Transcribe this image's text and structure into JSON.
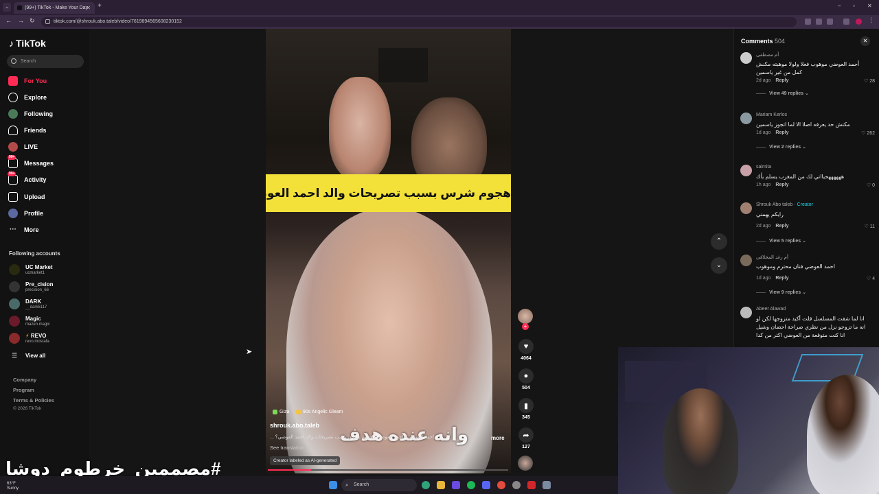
{
  "browser": {
    "tab_title": "(99+) TikTok - Make Your Day",
    "url": "tiktok.com/@shrouk.abo.taleb/video/7619894565608230152"
  },
  "sidebar": {
    "logo": "TikTok",
    "search_placeholder": "Search",
    "nav": [
      {
        "label": "For You",
        "icon": "home-icon",
        "active": true
      },
      {
        "label": "Explore",
        "icon": "compass-icon"
      },
      {
        "label": "Following",
        "icon": "following-icon"
      },
      {
        "label": "Friends",
        "icon": "friends-icon"
      },
      {
        "label": "LIVE",
        "icon": "live-icon"
      },
      {
        "label": "Messages",
        "icon": "messages-icon",
        "badge": "99+"
      },
      {
        "label": "Activity",
        "icon": "activity-icon",
        "badge": "99+"
      },
      {
        "label": "Upload",
        "icon": "upload-icon"
      },
      {
        "label": "Profile",
        "icon": "profile-icon"
      },
      {
        "label": "More",
        "icon": "more-icon"
      }
    ],
    "following_title": "Following accounts",
    "following": [
      {
        "name": "UC Market",
        "handle": "ucmarket1"
      },
      {
        "name": "Pre_cision",
        "handle": "precision_66"
      },
      {
        "name": "DARK",
        "handle": "__dark5117"
      },
      {
        "name": "Magic",
        "handle": "mazen.magic"
      },
      {
        "name": "REVO",
        "handle": "revo.mostafa"
      }
    ],
    "view_all": "View all",
    "footer": [
      "Company",
      "Program",
      "Terms & Policies",
      "© 2026 TikTok"
    ]
  },
  "video": {
    "banner": "هجوم شرس بسبب تصريحات والد احمد العوضي؟!",
    "subtitle": "وانه عنده هدف",
    "tags": [
      "Giza",
      "90s Angelic Gleam"
    ],
    "author": "shrouk.abo.taleb",
    "description": "احمد العوضي# احمد العوضي# هجوم شرس بسبب تصريحات والد احمد العوضي؟ ...",
    "more": "more",
    "see_translation": "See translation",
    "ai_label": "Creator labeled as AI-generated",
    "progress": 0.18,
    "likes": "4064",
    "comments": "504",
    "saves": "345",
    "shares": "127"
  },
  "comments_panel": {
    "title": "Comments",
    "count": "504",
    "items": [
      {
        "user": "أم مصطفى",
        "text": "أحمد العوضي موهوب فعلا ولولا موهبته مكنش كمل من غير ياسمين",
        "time": "2d ago",
        "reply": "Reply",
        "likes": "28",
        "views": "View 49 replies"
      },
      {
        "user": "Mariam Kerlos",
        "text": "مكنش حد يعرفه اصلا الا لما اتجوز ياسمين",
        "time": "1d ago",
        "reply": "Reply",
        "likes": "262",
        "views": "View 2 replies"
      },
      {
        "user": "salmita",
        "text": "ههههههحبااتي لك من المغرب يسلم بأك",
        "time": "1h ago",
        "reply": "Reply",
        "likes": "0"
      },
      {
        "user": "Shrouk Abo taleb",
        "creator": "· Creator",
        "text": "رايكم يهمني",
        "time": "2d ago",
        "reply": "Reply",
        "likes": "11",
        "views": "View 5 replies"
      },
      {
        "user": "أم رغد المخلافي",
        "text": "احمد العوضي فنان محترم وموهوب",
        "time": "1d ago",
        "reply": "Reply",
        "likes": "4",
        "views": "View 9 replies"
      },
      {
        "user": "Abeer Alawad",
        "text": "انا لما شفت المسلسل قلت أكيد متزوجها لكن لو انه ما تزوجو نزل من نظري صراحة احضان وشيل انا كنت متوقعة من العوضي اكثر من كدا",
        "time": "",
        "reply": "",
        "likes": ""
      }
    ]
  },
  "watermark": "#مصممين_خرطوم_دوشا",
  "taskbar": {
    "weather_temp": "63°F",
    "weather_text": "Sunny",
    "search": "Search"
  }
}
